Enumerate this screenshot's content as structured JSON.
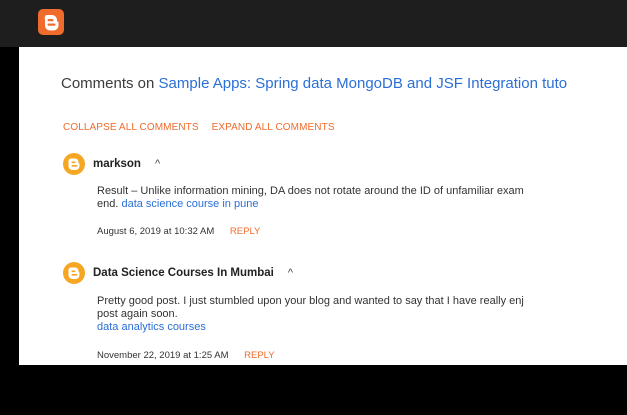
{
  "header": {
    "logo_icon": "blogger-logo-icon"
  },
  "page": {
    "heading_prefix": "Comments on ",
    "heading_link": "Sample Apps: Spring data MongoDB and JSF Integration tuto"
  },
  "actions": {
    "collapse_label": "COLLAPSE ALL COMMENTS",
    "expand_label": "EXPAND ALL COMMENTS"
  },
  "comments": [
    {
      "author": "markson",
      "caret": "^",
      "text_line1": "Result – Unlike information mining, DA does not rotate around the ID of unfamiliar exam",
      "text_line2_prefix": "end. ",
      "link": "data science course in pune",
      "timestamp": "August 6, 2019 at 10:32 AM",
      "reply_label": "REPLY"
    },
    {
      "author": "Data Science Courses In Mumbai",
      "caret": "^",
      "text_line1": "Pretty good post. I just stumbled upon your blog and wanted to say that I have really enj",
      "text_line2": "post again soon.",
      "link": "data analytics courses",
      "timestamp": "November 22, 2019 at 1:25 AM",
      "reply_label": "REPLY"
    }
  ],
  "colors": {
    "accent": "#ef6c2c",
    "link": "#2a6fd6",
    "background": "#ffffff"
  }
}
